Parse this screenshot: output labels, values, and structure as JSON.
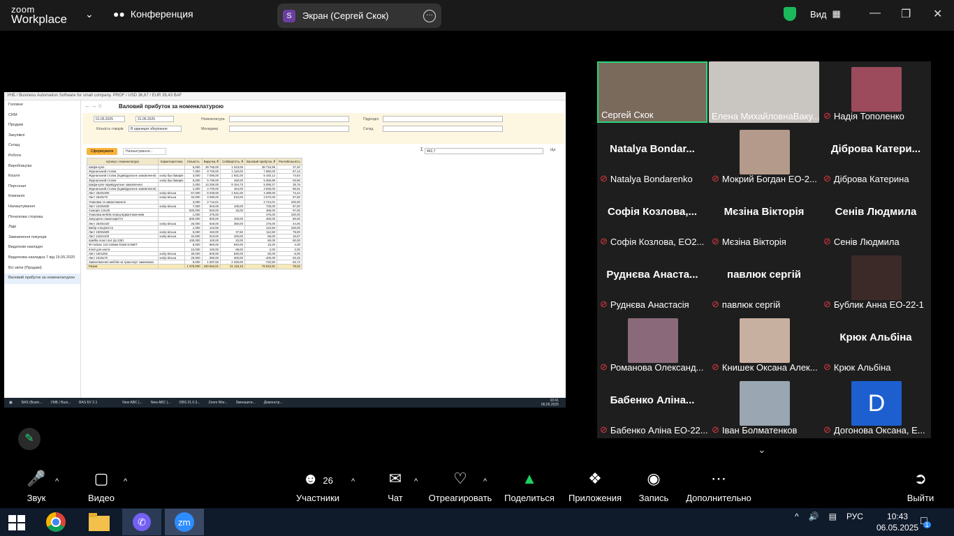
{
  "zoom": {
    "logo_top": "zoom",
    "logo_bottom": "Workplace",
    "meeting": "Конференция",
    "screen_label": "Экран (Сергей Скок)",
    "screen_initial": "S",
    "view": "Вид"
  },
  "shared": {
    "app_title": "УНБ / Business Automation Software for small company. PROF / USD 36,67 / EUR 39,43 BAF",
    "report_title": "Валовий прибуток за номенклатурою",
    "sidebar": [
      "Головне",
      "CRM",
      "Продажі",
      "Закупівлі",
      "Склад",
      "Роботи",
      "Виробництво",
      "Кошти",
      "Персонал",
      "Компанія",
      "Налаштування",
      "Початкова сторінка",
      "Ліди",
      "Замовлення покупців",
      "Видаткові накладні",
      "Видаткова накладна 7 від 15.05.2020",
      "Всі звіти (Продажі)",
      "Валовий прибуток за номенклатурою"
    ],
    "date_from": "01.05.2025",
    "date_to": "31.05.2025",
    "lbl_nomen": "Номенклатура",
    "lbl_subdiv": "Підрозділ",
    "lbl_qty": "Кількість товарів",
    "qty_value": "В одиницях зберігання",
    "lbl_manager": "Менеджер",
    "lbl_warehouse": "Склад",
    "btn_form": "Сформувати",
    "btn_settings": "Налаштування...",
    "sum_symbol": "Σ",
    "sum_value": "462,7",
    "more": "Ще",
    "columns": [
      "Артикул, Номенклатура",
      "Характеристика",
      "Кількість",
      "Виручка, ₴",
      "Собівартість, ₴",
      "Валовий прибуток, ₴",
      "Рентабельність"
    ],
    "rows": [
      [
        "Шафа-купе",
        "",
        "6,000",
        "39 750,00",
        "1 023,05",
        "38 716,95",
        "37,40"
      ],
      [
        "Журнальний столик",
        "",
        "7,000",
        "8 700,00",
        "1 120,00",
        "7 580,00",
        "87,13"
      ],
      [
        "Журнальний столик (індивідуальне замовлення)",
        "колір бук баварія",
        "3,000",
        "7 090,00",
        "1 931,00",
        "5 440,12",
        "74,84"
      ],
      [
        "Журнальний столик",
        "колір бук баварія",
        "5,000",
        "5 790,00",
        "430,00",
        "5 356,88",
        "93,86"
      ],
      [
        "Шафа-купе індивідуальне замовлення",
        "",
        "2,000",
        "14 250,00",
        "9 154,73",
        "5 095,27",
        "35,76"
      ],
      [
        "Журнальний столик (індивідуальне замовлення)",
        "",
        "1,000",
        "4 700,00",
        "164,00",
        "4 536,00",
        "96,51"
      ],
      [
        "Лист 2520х300",
        "колір вільха",
        "67,000",
        "6 030,00",
        "1 541,00",
        "4 489,00",
        "74,44"
      ],
      [
        "Лист 2540х70",
        "колір вільха",
        "34,000",
        "4 080,00",
        "510,00",
        "3 570,00",
        "87,50"
      ],
      [
        "Упаковка та завантаження",
        "",
        "3,000",
        "2 744,01",
        "",
        "2 744,01",
        "100,00"
      ],
      [
        "Лист 2420х600",
        "колір вільха",
        "7,000",
        "840,00",
        "105,00",
        "735,00",
        "87,50"
      ],
      [
        "Саморіз 3,5х25",
        "",
        "500,000",
        "500,00",
        "15,00",
        "485,00",
        "97,00"
      ],
      [
        "Упаковка меблів перед відвантаженням",
        "",
        "1,000",
        "475,00",
        "",
        "475,00",
        "100,00"
      ],
      [
        "Запущене самопокриття",
        "",
        "500,000",
        "500,00",
        "100,00",
        "400,00",
        "80,00"
      ],
      [
        "Лист 2540х420",
        "колір вільха",
        "25,000",
        "625,00",
        "350,00",
        "275,00",
        "44,00"
      ],
      [
        "Вибір спеціаліста",
        "",
        "1,000",
        "142,50",
        "",
        "142,50",
        "100,00"
      ],
      [
        "Лист 1900х500",
        "колір вільха",
        "5,000",
        "150,00",
        "37,50",
        "112,50",
        "75,00"
      ],
      [
        "Лист 1152х100",
        "колір вільха",
        "34,000",
        "510,00",
        "425,00",
        "85,00",
        "16,67"
      ],
      [
        "Шайба пласт.4х4 (ф 23Е)",
        "",
        "100,000",
        "100,00",
        "20,00",
        "80,00",
        "80,00"
      ],
      [
        "Фіттабокс 110-130мм білий SAMET",
        "",
        "8,000",
        "960,00",
        "940,00",
        "19,20",
        "2,00"
      ],
      [
        "Клей для канта",
        "",
        "10,000",
        "100,00",
        "98,00",
        "2,00",
        "2,00"
      ],
      [
        "Лист 150х250",
        "колір вільха",
        "30,000",
        "600,00",
        "630,00",
        "-30,00",
        "-5,00"
      ],
      [
        "Лист 1516х70",
        "колір вільха",
        "20,000",
        "390,00",
        "400,00",
        "-100,00",
        "-33,33"
      ],
      [
        "Завантаження меблів на транспорт замовника",
        "",
        "5,000",
        "1 587,50",
        "2 330,00",
        "-732,50",
        "-46,72"
      ]
    ],
    "total": [
      "Разом",
      "",
      "1 378,000",
      "100 654,01",
      "21 119,10",
      "79 534,91",
      "79,02"
    ],
    "taskbar_apps": [
      "BAS (Busin...",
      "УМБ / Busi...",
      "BAS БУ 2.1",
      "",
      "",
      "New ABC (...",
      "New ABC (...",
      "OBS 31.0.3...",
      "Zoom Wor...",
      "Зменшити...",
      "Демонстр..."
    ],
    "clock_time": "10:41",
    "clock_date": "06.05.2025",
    "lang": "УКР"
  },
  "participants": [
    {
      "big": "",
      "name": "Сергей Скок",
      "muted": false,
      "photo": "#7a6a5c"
    },
    {
      "big": "",
      "name": "Елена МихайловнаВаку...",
      "muted": false,
      "photo": "#c9c5c0"
    },
    {
      "big": "",
      "name": "Надія Тополенко",
      "muted": true,
      "photo": "#9c4b5d"
    },
    {
      "big": "Natalya Bondar...",
      "name": "Natalya Bondarenko",
      "muted": true,
      "photo": ""
    },
    {
      "big": "",
      "name": "Мокрий Богдан ЕО-2...",
      "muted": true,
      "photo": "#b49a8a"
    },
    {
      "big": "Діброва Катери...",
      "name": "Діброва Катерина",
      "muted": true,
      "photo": ""
    },
    {
      "big": "Софія Козлова,...",
      "name": "Софія Козлова, ЕО2...",
      "muted": true,
      "photo": ""
    },
    {
      "big": "Мєзіна Вікторія",
      "name": "Мєзіна Вікторія",
      "muted": true,
      "photo": ""
    },
    {
      "big": "Сенів Людмила",
      "name": "Сенів Людмила",
      "muted": true,
      "photo": ""
    },
    {
      "big": "Руднєва Анаста...",
      "name": "Руднєва Анастасія",
      "muted": true,
      "photo": ""
    },
    {
      "big": "павлюк сергій",
      "name": "павлюк сергій",
      "muted": true,
      "photo": ""
    },
    {
      "big": "",
      "name": "Бублик Анна ЕО-22-1",
      "muted": true,
      "photo": "#3b2a28"
    },
    {
      "big": "",
      "name": "Романова Олександ...",
      "muted": true,
      "photo": "#8a6a7a"
    },
    {
      "big": "",
      "name": "Книшек Оксана Алек...",
      "muted": true,
      "photo": "#c8b0a0"
    },
    {
      "big": "Крюк Альбіна",
      "name": "Крюк Альбіна",
      "muted": true,
      "photo": ""
    },
    {
      "big": "Бабенко Аліна...",
      "name": "Бабенко Аліна ЕО-22...",
      "muted": true,
      "photo": ""
    },
    {
      "big": "",
      "name": "Іван Болматенков",
      "muted": true,
      "photo": "#9aa6b2"
    },
    {
      "big": "D",
      "name": "Догонова Оксана, Е...",
      "muted": true,
      "photo": "#1d5fcf"
    }
  ],
  "toolbar": {
    "audio": "Звук",
    "video": "Видео",
    "participants": "Участники",
    "participants_count": "26",
    "chat": "Чат",
    "react": "Отреагировать",
    "share": "Поделиться",
    "apps": "Приложения",
    "record": "Запись",
    "more": "Дополнительно",
    "leave": "Выйти"
  },
  "taskbar": {
    "lang": "РУС",
    "time": "10:43",
    "date": "06.05.2025",
    "notif": "1"
  },
  "colors": {
    "accent": "#2ad47a",
    "share_green": "#1bd160",
    "mute_red": "#e0393e",
    "report_btn": "#f9b33a"
  }
}
